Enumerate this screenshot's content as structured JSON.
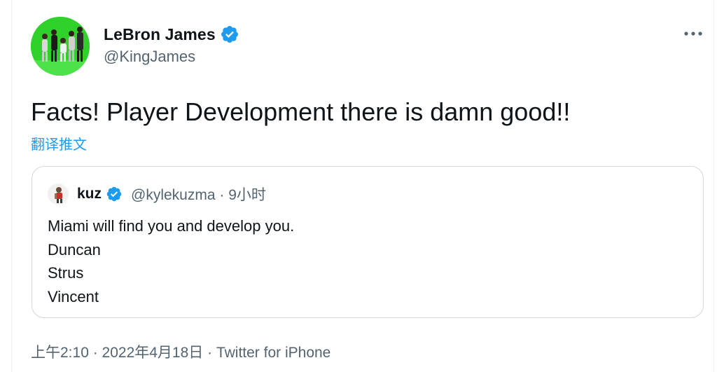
{
  "author": {
    "display_name": "LeBron James",
    "handle": "@KingJames",
    "verified_badge": "verified-badge-icon"
  },
  "more_menu": {
    "label": "•••",
    "icon": "more-icon"
  },
  "tweet": {
    "text": "Facts! Player Development there is damn good!!",
    "translate_label": "翻译推文"
  },
  "quote": {
    "author_name": "kuz",
    "meta": "@kylekuzma · 9小时",
    "lines": [
      "Miami will find you and develop you.",
      "Duncan",
      "Strus",
      "Vincent"
    ]
  },
  "footer": {
    "meta": "上午2:10 · 2022年4月18日 · Twitter for iPhone"
  },
  "colors": {
    "accent": "#1d9bf0",
    "muted": "#536471",
    "text": "#0f1419",
    "avatar_bg": "#2fd12a"
  }
}
